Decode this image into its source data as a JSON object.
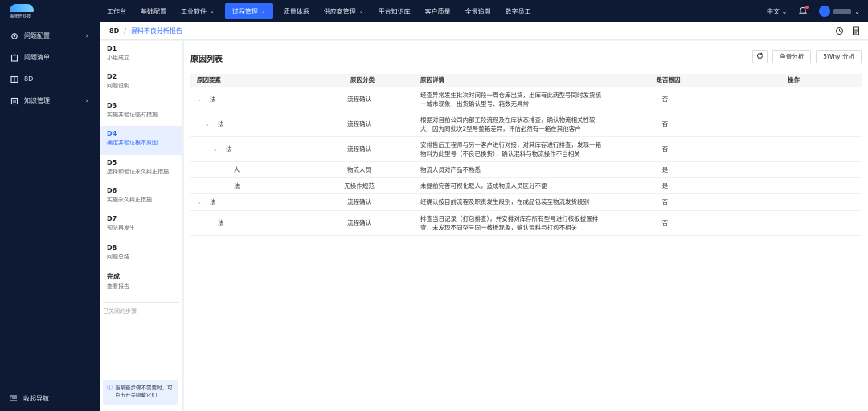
{
  "brand": {
    "logo_text": "海隆旺科技"
  },
  "topnav": {
    "items": [
      {
        "label": "工作台",
        "chevron": false
      },
      {
        "label": "基础配置",
        "chevron": false
      },
      {
        "label": "工业软件",
        "chevron": true
      },
      {
        "label": "过程管理",
        "chevron": true,
        "active": true
      },
      {
        "label": "质量体系",
        "chevron": false
      },
      {
        "label": "供应商管理",
        "chevron": true
      },
      {
        "label": "平台知识库",
        "chevron": false
      },
      {
        "label": "客户质量",
        "chevron": false
      },
      {
        "label": "全景追溯",
        "chevron": false
      },
      {
        "label": "数字员工",
        "chevron": false
      }
    ],
    "language": "中文",
    "accent": "#2f6bff"
  },
  "sidebar": {
    "items": [
      {
        "label": "问题配置",
        "icon": "gear-icon",
        "arrow": true
      },
      {
        "label": "问题清单",
        "icon": "clipboard-icon",
        "arrow": false
      },
      {
        "label": "8D",
        "icon": "grid-icon",
        "arrow": false
      },
      {
        "label": "知识管理",
        "icon": "book-icon",
        "arrow": true
      }
    ],
    "collapse_label": "收起导航"
  },
  "breadcrumb": {
    "root": "8D",
    "separator": "/",
    "current": "混料不良分析报告"
  },
  "steps": {
    "items": [
      {
        "code": "D1",
        "desc": "小组成立"
      },
      {
        "code": "D2",
        "desc": "问题说明"
      },
      {
        "code": "D3",
        "desc": "实施并验证临时措施"
      },
      {
        "code": "D4",
        "desc": "确定并验证根本原因",
        "active": true
      },
      {
        "code": "D5",
        "desc": "选择和验证永久纠正措施"
      },
      {
        "code": "D6",
        "desc": "实施永久纠正措施"
      },
      {
        "code": "D7",
        "desc": "预防再发生"
      },
      {
        "code": "D8",
        "desc": "问题总结"
      },
      {
        "code": "完成",
        "desc": "查看报告"
      }
    ],
    "closed_label": "已关闭的步骤",
    "hint": "当某些步骤不需要时，可点击开关隐藏它们"
  },
  "main": {
    "title": "原因列表",
    "buttons": {
      "fishbone": "鱼骨分析",
      "why5": "5Why 分析"
    },
    "columns": [
      "原因要素",
      "原因分类",
      "原因详情",
      "是否根因",
      "操作"
    ],
    "rows": [
      {
        "factor": "法",
        "expander": "⌄",
        "indent": 0,
        "category": "流程确认",
        "detail": "经查异常发生批次时间段一周仓库出货，出库有此两型号同时发货统一城市现象，出货确认型号、箱数无异常",
        "root": "否"
      },
      {
        "factor": "法",
        "expander": "⌄",
        "indent": 1,
        "category": "流程确认",
        "detail": "根据对目前公司内部工段流程及在库状态排查，确认物流相关性较大，因为同批次2型号整箱差异，评估必然有一箱在其他客户",
        "root": "否"
      },
      {
        "factor": "法",
        "expander": "⌄",
        "indent": 2,
        "category": "流程确认",
        "detail": "安排售后工程师与另一客户进行对接，对其库存进行排查，发现一箱物料为此型号（不良已换货），确认混料与物流操作不当相关",
        "root": "否"
      },
      {
        "factor": "人",
        "expander": "",
        "indent": 3,
        "category": "物流人员",
        "detail": "物流人员对产品不熟悉",
        "root": "是"
      },
      {
        "factor": "法",
        "expander": "",
        "indent": 3,
        "category": "无操作规范",
        "detail": "未提前完善可视化取人，造成物流人员区分不便",
        "root": "是"
      },
      {
        "factor": "法",
        "expander": "⌄",
        "indent": 0,
        "category": "流程确认",
        "detail": "经确认按目前流程及职责发生段别，在成品包装至物流发货段别",
        "root": "否"
      },
      {
        "factor": "法",
        "expander": "",
        "indent": 1,
        "category": "流程确认",
        "detail": "排查当日记录（打包排查），并安排对库存所有型号进行核板拔置排查，未发现不同型号同一核板现象，确认混料与打包不相关",
        "root": "否"
      }
    ]
  }
}
